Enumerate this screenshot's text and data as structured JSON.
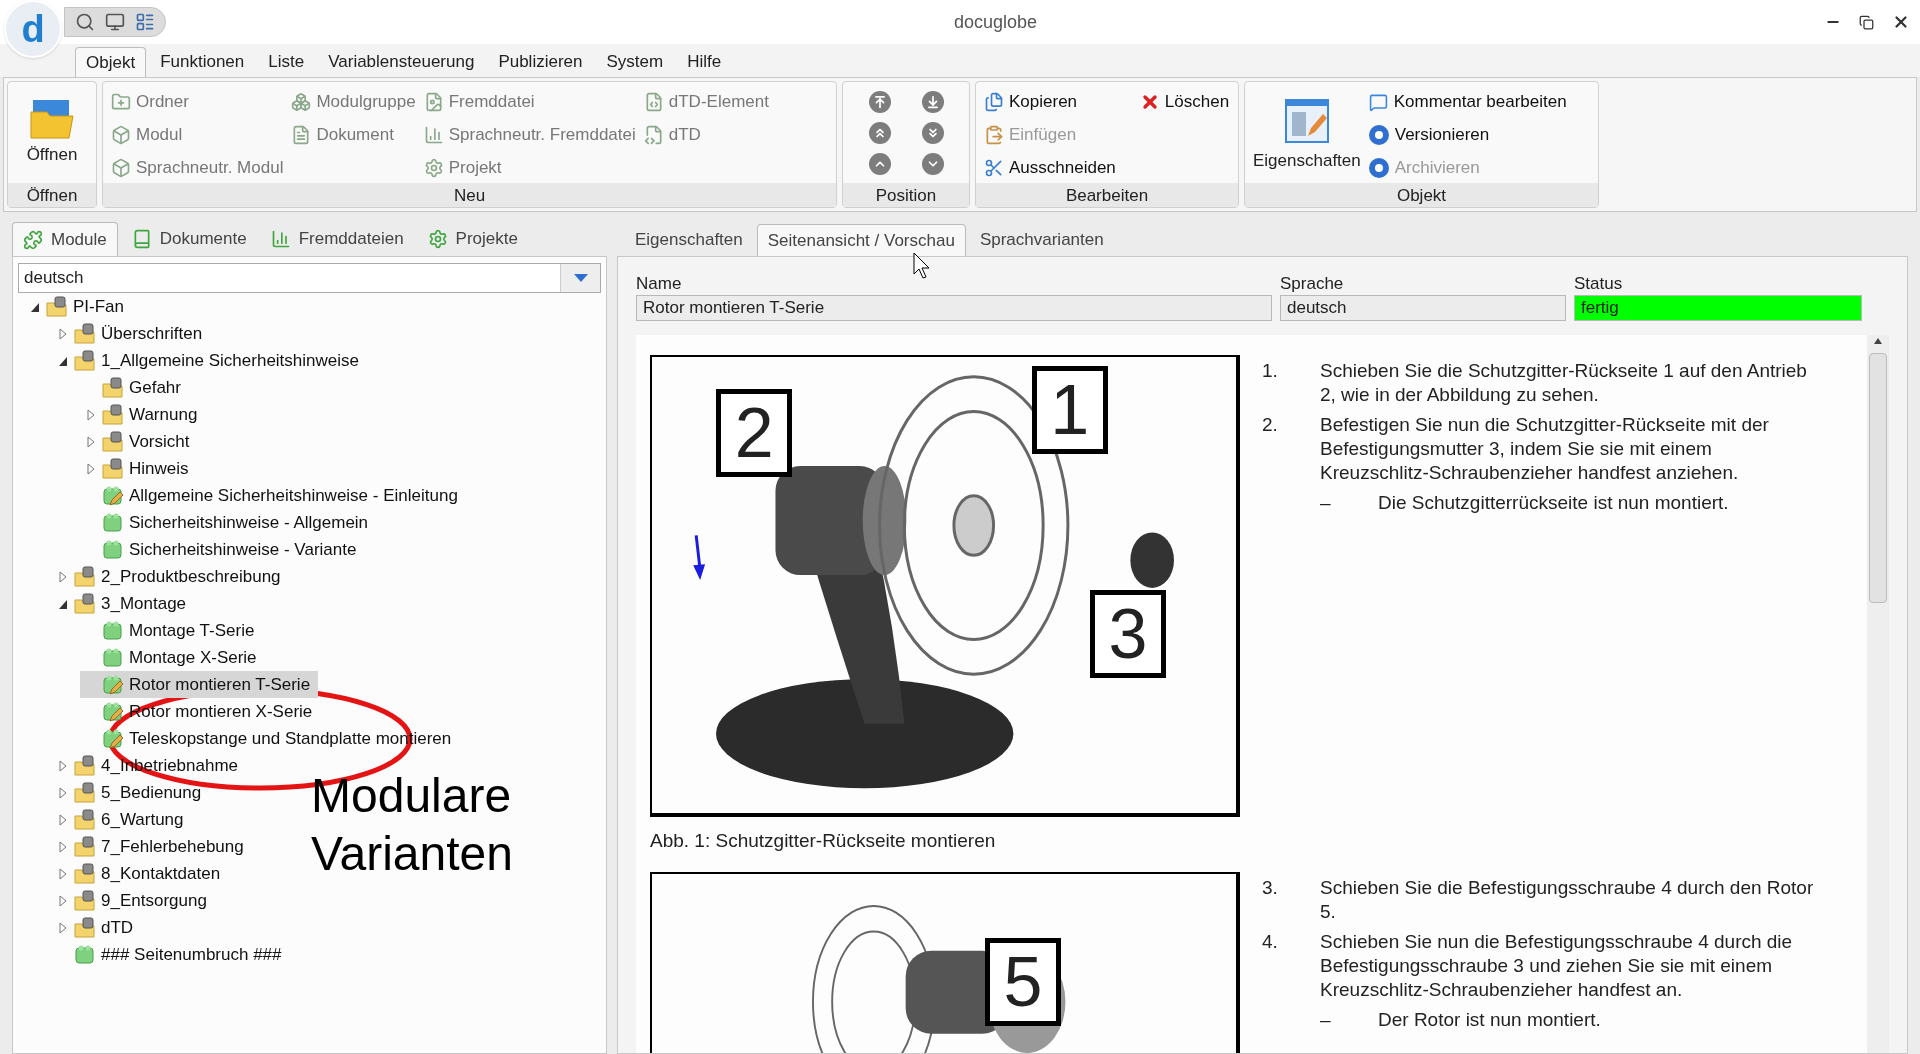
{
  "window": {
    "title": "docuglobe",
    "logo_letter": "d"
  },
  "menu_tabs": [
    {
      "label": "Objekt",
      "selected": true
    },
    {
      "label": "Funktionen",
      "selected": false
    },
    {
      "label": "Liste",
      "selected": false
    },
    {
      "label": "Variablensteuerung",
      "selected": false
    },
    {
      "label": "Publizieren",
      "selected": false
    },
    {
      "label": "System",
      "selected": false
    },
    {
      "label": "Hilfe",
      "selected": false
    }
  ],
  "ribbon": {
    "open": {
      "button": "Öffnen",
      "label": "Öffnen"
    },
    "new": {
      "label": "Neu",
      "columns": [
        [
          {
            "label": "Ordner",
            "disabled": true
          },
          {
            "label": "Modul",
            "disabled": true
          },
          {
            "label": "Sprachneutr. Modul",
            "disabled": true
          }
        ],
        [
          {
            "label": "Modulgruppe",
            "disabled": true
          },
          {
            "label": "Dokument",
            "disabled": true
          }
        ],
        [
          {
            "label": "Fremddatei",
            "disabled": true
          },
          {
            "label": "Sprachneutr. Fremddatei",
            "disabled": true
          },
          {
            "label": "Projekt",
            "disabled": true
          }
        ],
        [
          {
            "label": "dTD-Element",
            "disabled": true
          },
          {
            "label": "dTD",
            "disabled": true
          }
        ]
      ]
    },
    "position": {
      "label": "Position"
    },
    "edit": {
      "label": "Bearbeiten",
      "columns": [
        [
          {
            "label": "Kopieren",
            "disabled": false
          },
          {
            "label": "Einfügen",
            "disabled": true
          },
          {
            "label": "Ausschneiden",
            "disabled": false
          }
        ],
        [
          {
            "label": "Löschen",
            "disabled": false
          }
        ]
      ]
    },
    "object": {
      "label": "Objekt",
      "big_button": "Eigenschaften",
      "items": [
        {
          "label": "Kommentar bearbeiten",
          "disabled": false
        },
        {
          "label": "Versionieren",
          "disabled": false
        },
        {
          "label": "Archivieren",
          "disabled": true
        }
      ]
    }
  },
  "left_tabs": [
    {
      "label": "Module",
      "selected": true
    },
    {
      "label": "Dokumente",
      "selected": false
    },
    {
      "label": "Fremddateien",
      "selected": false
    },
    {
      "label": "Projekte",
      "selected": false
    }
  ],
  "language_select": {
    "value": "deutsch"
  },
  "tree": [
    {
      "label": "PI-Fan",
      "kind": "folder",
      "expanded": true,
      "selected": false,
      "children": [
        {
          "label": "Überschriften",
          "kind": "folder",
          "expanded": false,
          "selected": false
        },
        {
          "label": "1_Allgemeine Sicherheitshinweise",
          "kind": "folder",
          "expanded": true,
          "selected": false,
          "children": [
            {
              "label": "Gefahr",
              "kind": "folder",
              "selected": false
            },
            {
              "label": "Warnung",
              "kind": "folder",
              "expanded": false,
              "selected": false
            },
            {
              "label": "Vorsicht",
              "kind": "folder",
              "expanded": false,
              "selected": false
            },
            {
              "label": "Hinweis",
              "kind": "folder",
              "expanded": false,
              "selected": false
            },
            {
              "label": "Allgemeine Sicherheitshinweise - Einleitung",
              "kind": "module-edited",
              "selected": false
            },
            {
              "label": "Sicherheitshinweise - Allgemein",
              "kind": "module",
              "selected": false
            },
            {
              "label": "Sicherheitshinweise - Variante",
              "kind": "module",
              "selected": false
            }
          ]
        },
        {
          "label": "2_Produktbeschreibung",
          "kind": "folder",
          "expanded": false,
          "selected": false
        },
        {
          "label": "3_Montage",
          "kind": "folder",
          "expanded": true,
          "selected": false,
          "children": [
            {
              "label": "Montage T-Serie",
              "kind": "module",
              "selected": false
            },
            {
              "label": "Montage X-Serie",
              "kind": "module",
              "selected": false
            },
            {
              "label": "Rotor montieren T-Serie",
              "kind": "module-edited",
              "selected": true
            },
            {
              "label": "Rotor montieren X-Serie",
              "kind": "module-edited",
              "selected": false
            },
            {
              "label": "Teleskopstange und Standplatte montieren",
              "kind": "module-edited",
              "selected": false
            }
          ]
        },
        {
          "label": "4_Inbetriebnahme",
          "kind": "folder",
          "expanded": false,
          "selected": false
        },
        {
          "label": "5_Bedienung",
          "kind": "folder",
          "expanded": false,
          "selected": false
        },
        {
          "label": "6_Wartung",
          "kind": "folder",
          "expanded": false,
          "selected": false
        },
        {
          "label": "7_Fehlerbehebung",
          "kind": "folder",
          "expanded": false,
          "selected": false
        },
        {
          "label": "8_Kontaktdaten",
          "kind": "folder",
          "expanded": false,
          "selected": false
        },
        {
          "label": "9_Entsorgung",
          "kind": "folder",
          "expanded": false,
          "selected": false
        },
        {
          "label": "dTD",
          "kind": "folder",
          "expanded": false,
          "selected": false
        },
        {
          "label": "### Seitenumbruch ###",
          "kind": "module",
          "selected": false
        }
      ]
    }
  ],
  "annotation": {
    "text": "Modulare Varianten"
  },
  "right_tabs": [
    {
      "label": "Eigenschaften",
      "selected": false
    },
    {
      "label": "Seitenansicht / Vorschau",
      "selected": true
    },
    {
      "label": "Sprachvarianten",
      "selected": false
    }
  ],
  "fields": [
    {
      "label": "Name",
      "value": "Rotor montieren T-Serie"
    },
    {
      "label": "Sprache",
      "value": "deutsch"
    },
    {
      "label": "Status",
      "value": "fertig",
      "color": "#00ff00"
    }
  ],
  "document": {
    "sections": [
      {
        "figure": {
          "callouts": [
            "2",
            "1",
            "3"
          ],
          "caption": "Abb. 1: Schutzgitter-Rückseite montieren"
        },
        "steps": [
          {
            "kind": "step",
            "marker": "1.",
            "text": "Schieben Sie die Schutzgitter-Rückseite 1 auf den Antrieb 2, wie in der Abbildung zu sehen."
          },
          {
            "kind": "step",
            "marker": "2.",
            "text": "Befestigen Sie nun die Schutzgitter-Rückseite mit der Befestigungsmutter 3, indem Sie sie mit einem Kreuzschlitz-Schraubenzieher handfest anziehen."
          },
          {
            "kind": "result",
            "marker": "–",
            "text": "Die Schutzgitterrückseite ist nun montiert."
          }
        ]
      },
      {
        "figure": {
          "callouts": [
            "5"
          ]
        },
        "steps": [
          {
            "kind": "step",
            "marker": "3.",
            "text": "Schieben Sie die Befestigungsschraube 4 durch den Rotor 5."
          },
          {
            "kind": "step",
            "marker": "4.",
            "text": "Schieben Sie nun die Befestigungsschraube 4 durch die Befestigungsschraube 3 und ziehen Sie sie mit einem Kreuzschlitz-Schraubenzieher handfest an."
          },
          {
            "kind": "result",
            "marker": "–",
            "text": "Der Rotor ist nun montiert."
          }
        ]
      }
    ]
  }
}
